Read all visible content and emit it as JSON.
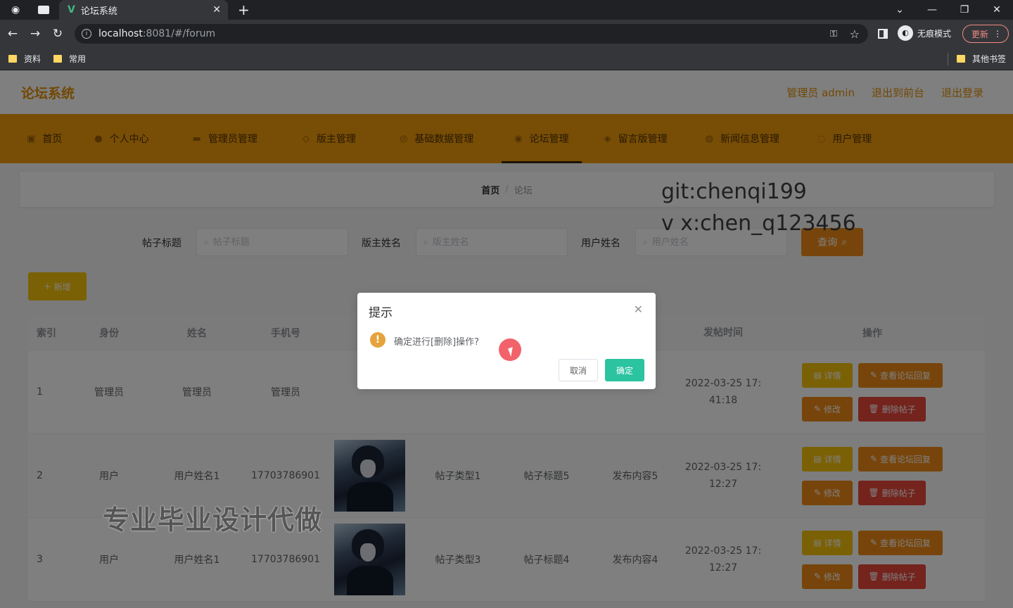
{
  "browser": {
    "tab_title": "论坛系统",
    "url_host": "localhost",
    "url_rest": ":8081/#/forum",
    "incognito_label": "无痕模式",
    "update_label": "更新",
    "bookmarks": [
      "资料",
      "常用"
    ],
    "other_bookmarks": "其他书签"
  },
  "app": {
    "title": "论坛系统",
    "header_links": [
      "管理员 admin",
      "退出到前台",
      "退出登录"
    ]
  },
  "menu": [
    {
      "label": "首页",
      "icon": "home-icon"
    },
    {
      "label": "个人中心",
      "icon": "user-icon"
    },
    {
      "label": "管理员管理",
      "icon": "admin-icon"
    },
    {
      "label": "版主管理",
      "icon": "moderator-icon"
    },
    {
      "label": "基础数据管理",
      "icon": "data-icon"
    },
    {
      "label": "论坛管理",
      "icon": "forum-icon",
      "active": true
    },
    {
      "label": "留言版管理",
      "icon": "message-icon"
    },
    {
      "label": "新闻信息管理",
      "icon": "news-icon"
    },
    {
      "label": "用户管理",
      "icon": "users-icon"
    }
  ],
  "breadcrumb": {
    "home": "首页",
    "sep": "/",
    "current": "论坛"
  },
  "search": {
    "title_label": "帖子标题",
    "title_placeholder": "帖子标题",
    "moderator_label": "版主姓名",
    "moderator_placeholder": "版主姓名",
    "user_label": "用户姓名",
    "user_placeholder": "用户姓名",
    "query_label": "查询"
  },
  "add_label": "新增",
  "table": {
    "headers": [
      "索引",
      "身份",
      "姓名",
      "手机号",
      "",
      "",
      "",
      "",
      "发帖时间",
      "操作"
    ],
    "rows": [
      {
        "index": "1",
        "role": "管理员",
        "name": "管理员",
        "phone": "管理员",
        "type": "",
        "post_title": "",
        "content": "",
        "time1": "2022-03-25 17:",
        "time2": "41:18"
      },
      {
        "index": "2",
        "role": "用户",
        "name": "用户姓名1",
        "phone": "17703786901",
        "type": "帖子类型1",
        "post_title": "帖子标题5",
        "content": "发布内容5",
        "time1": "2022-03-25 17:",
        "time2": "12:27"
      },
      {
        "index": "3",
        "role": "用户",
        "name": "用户姓名1",
        "phone": "17703786901",
        "type": "帖子类型3",
        "post_title": "帖子标题4",
        "content": "发布内容4",
        "time1": "2022-03-25 17:",
        "time2": "12:27"
      }
    ],
    "ops": {
      "detail": "详情",
      "reply": "查看论坛回复",
      "edit": "修改",
      "delete": "删除帖子"
    }
  },
  "dialog": {
    "title": "提示",
    "message": "确定进行[删除]操作?",
    "cancel": "取消",
    "confirm": "确定"
  },
  "watermark": {
    "line1": "git:chenqi199",
    "line2": "v x:chen_q123456",
    "big": "专业毕业设计代做"
  }
}
